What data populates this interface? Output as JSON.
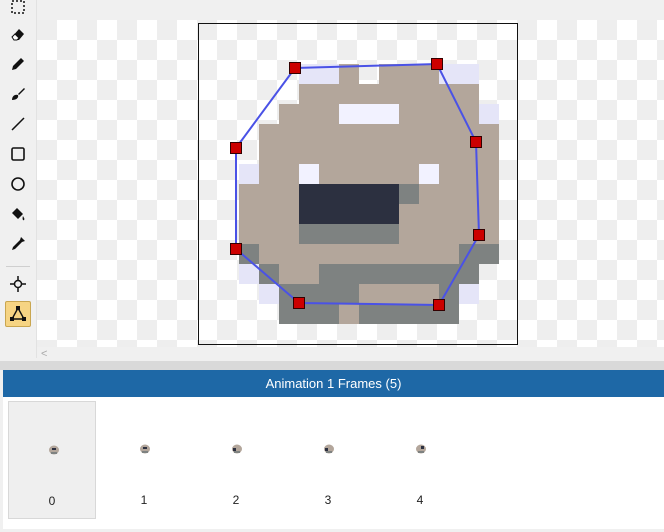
{
  "tools": [
    {
      "name": "marquee-select-icon",
      "active": false
    },
    {
      "name": "eraser-icon",
      "active": false
    },
    {
      "name": "pencil-icon",
      "active": false
    },
    {
      "name": "brush-icon",
      "active": false
    },
    {
      "name": "line-icon",
      "active": false
    },
    {
      "name": "rectangle-icon",
      "active": false
    },
    {
      "name": "ellipse-icon",
      "active": false
    },
    {
      "name": "fill-bucket-icon",
      "active": false
    },
    {
      "name": "eyedropper-icon",
      "active": false
    },
    {
      "name": "origin-point-icon",
      "active": false
    },
    {
      "name": "polygon-collision-icon",
      "active": true
    }
  ],
  "colors": {
    "header": "#1e68a6",
    "tool_active": "#f6d483",
    "polygon_stroke": "#4a52e6",
    "vertex_fill": "#cc0000",
    "sprite_light": "#b3a69b",
    "sprite_gray": "#7e8281",
    "sprite_eye": "#2c3040",
    "sprite_white": "#f2f2ff",
    "sprite_edge": "#e5e5f8"
  },
  "sprite": {
    "grid_size": 16,
    "palette": {
      "L": "#b3a69b",
      "G": "#7e8281",
      "D": "#2c3040",
      "W": "#f2f2ff",
      "E": "#e5e5f8"
    },
    "rows": [
      "................",
      "................",
      ".....EEL LLLEE..",
      ".....LLLLLLLLL..",
      "....LLLWWWLLLLE.",
      "...LLLLLLLLLLLL.",
      "...LLLLLLLLLLLL.",
      "..ELLWLLLLLWLLL.",
      "..LLLDDDDDGLLLL.",
      "..LLLDDDDDLLLLL.",
      "..LLLGGGGGLLLLL.",
      "..GLLLLLLLLLLGG.",
      "..EGLLGGGGGGGG..",
      "...EGGGGLLLLGE..",
      "....GGGLGGGGG...",
      "................"
    ]
  },
  "polygon_vertices_px": [],
  "animation": {
    "title": "Animation 1 Frames (5)",
    "frames": [
      {
        "label": "0",
        "selected": true
      },
      {
        "label": "1",
        "selected": false
      },
      {
        "label": "2",
        "selected": false
      },
      {
        "label": "3",
        "selected": false
      },
      {
        "label": "4",
        "selected": false
      }
    ]
  },
  "scroll": {
    "left_arrow": "<"
  }
}
